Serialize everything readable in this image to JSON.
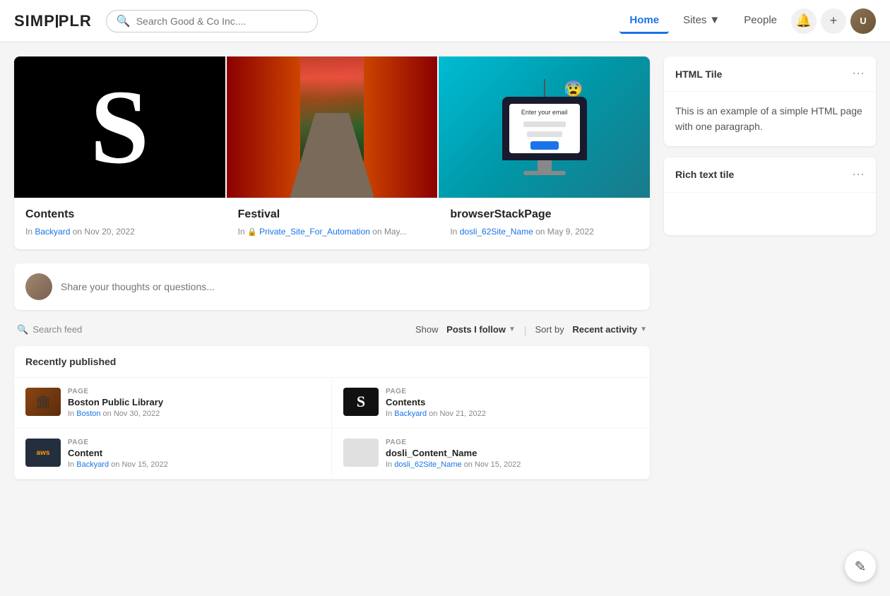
{
  "header": {
    "logo": "SIMPPLR",
    "search_placeholder": "Search Good & Co Inc....",
    "nav_items": [
      {
        "label": "Home",
        "active": true
      },
      {
        "label": "Sites",
        "dropdown": true
      },
      {
        "label": "People",
        "active": false
      }
    ],
    "notification_icon": "🔔",
    "add_icon": "+",
    "user_initials": "U"
  },
  "cards": [
    {
      "type": "s-logo",
      "title": "Contents",
      "site": "Backyard",
      "date": "Nov 20, 2022",
      "prefix": "In"
    },
    {
      "type": "festival",
      "title": "Festival",
      "site": "Private_Site_For_Automation",
      "date": "May...",
      "prefix": "In",
      "private": true
    },
    {
      "type": "browser",
      "title": "browserStackPage",
      "site": "dosli_62Site_Name",
      "date": "May 9, 2022",
      "prefix": "In"
    }
  ],
  "share_box": {
    "placeholder": "Share your thoughts or questions..."
  },
  "feed_controls": {
    "search_placeholder": "Search feed",
    "show_label": "Show",
    "show_value": "Posts I follow",
    "sort_label": "Sort by",
    "sort_value": "Recent activity"
  },
  "recently_published": {
    "header": "Recently published",
    "items": [
      {
        "type": "PAGE",
        "thumb": "library",
        "title": "Boston Public Library",
        "site": "Boston",
        "date": "Nov 30, 2022"
      },
      {
        "type": "PAGE",
        "thumb": "s",
        "title": "Contents",
        "site": "Backyard",
        "date": "Nov 21, 2022"
      },
      {
        "type": "PAGE",
        "thumb": "aws",
        "title": "Content",
        "site": "Backyard",
        "date": "Nov 15, 2022"
      },
      {
        "type": "PAGE",
        "thumb": "dosli",
        "title": "dosli_Content_Name",
        "site": "dosli_62Site_Name",
        "date": "Nov 15, 2022"
      }
    ]
  },
  "html_tile": {
    "title": "HTML Tile",
    "content": "This is an example of a simple HTML page with one paragraph."
  },
  "rich_text_tile": {
    "title": "Rich text tile"
  },
  "colors": {
    "accent": "#1a73e8",
    "border": "#e0e0e0",
    "bg": "#f5f5f5"
  }
}
